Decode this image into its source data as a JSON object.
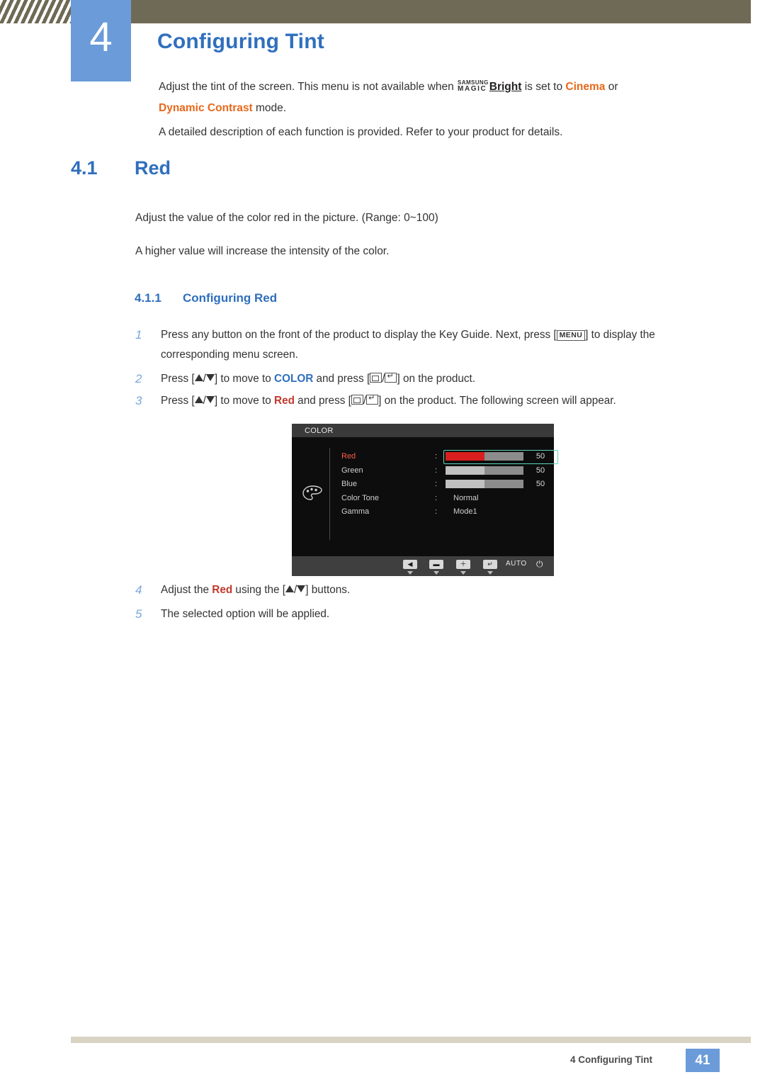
{
  "header": {
    "chapter_number": "4",
    "chapter_title": "Configuring Tint"
  },
  "intro": {
    "line1_part1": "Adjust the tint of the screen. This menu is not available when ",
    "magic_top": "SAMSUNG",
    "magic_bottom": "MAGIC",
    "bright": "Bright",
    "line1_part2": " is set to ",
    "cinema": "Cinema",
    "line1_part3": " or",
    "dynamic_contrast": "Dynamic Contrast",
    "line1_part4": " mode.",
    "line2": "A detailed description of each function is provided. Refer to your product for details."
  },
  "section": {
    "number": "4.1",
    "title": "Red",
    "para_a": "Adjust the value of the color red in the picture. (Range: 0~100)",
    "para_b": "A higher value will increase the intensity of the color."
  },
  "subsection": {
    "number": "4.1.1",
    "title": "Configuring Red"
  },
  "steps": [
    {
      "num": "1",
      "part1": "Press any button on the front of the product to display the Key Guide. Next, press [",
      "key": "MENU",
      "part2": "] to display the corresponding menu screen."
    },
    {
      "num": "2",
      "part1": "Press [",
      "part2": "/",
      "part3": "] to move to ",
      "target": "COLOR",
      "part4": " and press [",
      "part5": "/",
      "part6": "] on the product."
    },
    {
      "num": "3",
      "part1": "Press [",
      "part2": "/",
      "part3": "] to move to ",
      "target": "Red",
      "part4": " and press [",
      "part5": "/",
      "part6": "] on the product. The following screen will appear."
    },
    {
      "num": "4",
      "part1": "Adjust the ",
      "target": "Red",
      "part2": " using the [",
      "part3": "/",
      "part4": "] buttons."
    },
    {
      "num": "5",
      "part1": "The selected option will be applied."
    }
  ],
  "osd": {
    "title": "COLOR",
    "rows": [
      {
        "label": "Red",
        "colon": ":",
        "type": "bar",
        "value": "50",
        "fill_percent": 50,
        "selected": true
      },
      {
        "label": "Green",
        "colon": ":",
        "type": "bar",
        "value": "50",
        "fill_percent": 50,
        "selected": false
      },
      {
        "label": "Blue",
        "colon": ":",
        "type": "bar",
        "value": "50",
        "fill_percent": 50,
        "selected": false
      },
      {
        "label": "Color Tone",
        "colon": ":",
        "type": "text",
        "value": "Normal",
        "selected": false
      },
      {
        "label": "Gamma",
        "colon": ":",
        "type": "text",
        "value": "Mode1",
        "selected": false
      }
    ],
    "buttons": [
      "◀",
      "▬",
      "＋",
      "↵"
    ],
    "auto_label": "AUTO",
    "power_icon": "⏻"
  },
  "footer": {
    "text": "4 Configuring Tint",
    "page": "41"
  },
  "colors": {
    "accent_blue": "#2f6fbe",
    "badge_blue": "#6b9bd9",
    "header_band": "#6e6a56",
    "orange": "#e8681a",
    "red_bar": "#d81f1f",
    "osd_select": "#5ad6c0"
  }
}
